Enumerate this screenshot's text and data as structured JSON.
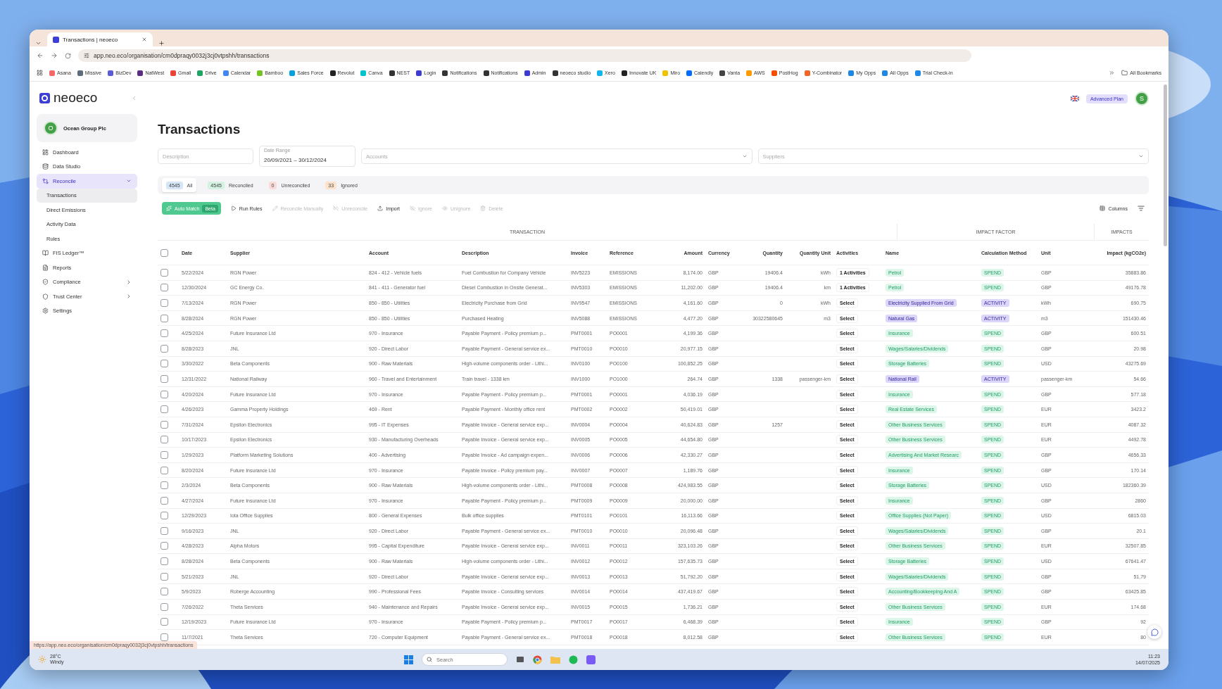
{
  "browser": {
    "tab_title": "Transactions | neoeco",
    "url": "app.neo.eco/organisation/cm0dpraqy0032j3cj0vtpshh/transactions",
    "bookmarks": [
      {
        "label": "Asana",
        "color": "#f06a6a"
      },
      {
        "label": "Missive",
        "color": "#5c6b7a"
      },
      {
        "label": "BizDev",
        "color": "#5b5bd6"
      },
      {
        "label": "NatWest",
        "color": "#5a2d82"
      },
      {
        "label": "Gmail",
        "color": "#ea4335"
      },
      {
        "label": "Drive",
        "color": "#1fa463"
      },
      {
        "label": "Calendar",
        "color": "#4285f4"
      },
      {
        "label": "Bamboo",
        "color": "#73c41d"
      },
      {
        "label": "Sales Force",
        "color": "#00a1e0"
      },
      {
        "label": "Revolut",
        "color": "#222222"
      },
      {
        "label": "Canva",
        "color": "#00c4cc"
      },
      {
        "label": "NEST",
        "color": "#333333"
      },
      {
        "label": "Login",
        "color": "#3b3bd6"
      },
      {
        "label": "Notifications",
        "color": "#333333"
      },
      {
        "label": "Notifications",
        "color": "#333333"
      },
      {
        "label": "Admin",
        "color": "#3b3bd6"
      },
      {
        "label": "neoeco studio",
        "color": "#333333"
      },
      {
        "label": "Xero",
        "color": "#13b5ea"
      },
      {
        "label": "Innovate UK",
        "color": "#222222"
      },
      {
        "label": "Miro",
        "color": "#f2c200"
      },
      {
        "label": "Calendly",
        "color": "#006bff"
      },
      {
        "label": "Vanta",
        "color": "#444444"
      },
      {
        "label": "AWS",
        "color": "#ff9900"
      },
      {
        "label": "PostHog",
        "color": "#f54e00"
      },
      {
        "label": "Y-Combinator",
        "color": "#f26522"
      },
      {
        "label": "My Opps",
        "color": "#1e88e5"
      },
      {
        "label": "All Opps",
        "color": "#1e88e5"
      },
      {
        "label": "Trial Check-in",
        "color": "#1e88e5"
      }
    ],
    "all_bookmarks": "All Bookmarks",
    "status_url": "https://app.neo.eco/organisation/cm0dpraqy0032j3cj0vtpshh/transactions"
  },
  "sidebar": {
    "logo": "neoeco",
    "organisation": {
      "initial": "O",
      "name": "Ocean Group Plc"
    },
    "items": [
      {
        "label": "Dashboard",
        "selected": false
      },
      {
        "label": "Data Studio",
        "selected": false
      },
      {
        "label": "Reconcile",
        "selected": true,
        "expanded": true,
        "children": [
          {
            "label": "Transactions",
            "selected": true
          },
          {
            "label": "Direct Emissions",
            "selected": false
          },
          {
            "label": "Activity Data",
            "selected": false
          },
          {
            "label": "Rules",
            "selected": false
          }
        ]
      },
      {
        "label": "FIS Ledger™",
        "selected": false
      },
      {
        "label": "Reports",
        "selected": false
      },
      {
        "label": "Compliance",
        "selected": false,
        "expanded": false
      },
      {
        "label": "Trust Center",
        "selected": false,
        "expanded": false
      },
      {
        "label": "Settings",
        "selected": false
      }
    ]
  },
  "header": {
    "plan": "Advanced Plan",
    "avatar": "S"
  },
  "page_title": "Transactions",
  "filters": {
    "description": {
      "placeholder": "Description"
    },
    "date_range": {
      "label": "Date Range",
      "value": "20/09/2021 – 30/12/2024"
    },
    "accounts": {
      "placeholder": "Accounts"
    },
    "suppliers": {
      "placeholder": "Suppliers"
    }
  },
  "tabs": [
    {
      "count": "4545",
      "label": "All",
      "selected": true,
      "color": "#d6e6f7"
    },
    {
      "count": "4545",
      "label": "Reconciled",
      "selected": false,
      "color": "#d3f2e2"
    },
    {
      "count": "0",
      "label": "Unreconciled",
      "selected": false,
      "color": "#fbdada"
    },
    {
      "count": "33",
      "label": "Ignored",
      "selected": false,
      "color": "#fde3cc"
    }
  ],
  "toolbar": {
    "buttons": [
      {
        "label": "Auto Match",
        "badge": "Beta",
        "kind": "primary",
        "disabled": false
      },
      {
        "label": "Run Rules",
        "kind": "plain",
        "disabled": false
      },
      {
        "label": "Reconcile Manually",
        "kind": "plain",
        "disabled": true
      },
      {
        "label": "Unreconcile",
        "kind": "plain",
        "disabled": true
      },
      {
        "label": "Import",
        "kind": "plain",
        "disabled": false
      },
      {
        "label": "Ignore",
        "kind": "plain",
        "disabled": true
      },
      {
        "label": "Unignore",
        "kind": "plain",
        "disabled": true
      },
      {
        "label": "Delete",
        "kind": "plain",
        "disabled": true
      }
    ],
    "columns_button": "Columns"
  },
  "table": {
    "groups": [
      "TRANSACTION",
      "IMPACT FACTOR",
      "IMPACTS"
    ],
    "select_all_checked": false,
    "columns": [
      "Date",
      "Supplier",
      "Account",
      "Description",
      "Invoice",
      "Reference",
      "Amount",
      "Currency",
      "Quantity",
      "Quantity Unit",
      "Activities",
      "Name",
      "Calculation Method",
      "Unit",
      "Impact (kgCO2e)"
    ],
    "rows": [
      {
        "checked": false,
        "date": "5/22/2024",
        "supplier": "RGN Power",
        "account": "824 - 412 - Vehicle fuels",
        "description": "Fuel Combustion for Company Vehicle",
        "invoice": "INV5223",
        "reference": "EMISSIONS",
        "amount": "8,174.00",
        "currency": "GBP",
        "quantity": "19406.4",
        "quantity_unit": "kWh",
        "activities": "1 Activities",
        "name": "Petrol",
        "kind": "spend",
        "method": "SPEND",
        "unit": "GBP",
        "impact": "35883.86"
      },
      {
        "checked": false,
        "date": "12/30/2024",
        "supplier": "GC Energy Co.",
        "account": "841 - 411 - Generator fuel",
        "description": "Diesel Combustion in Onsite Generat...",
        "invoice": "INV5303",
        "reference": "EMISSIONS",
        "amount": "11,202.00",
        "currency": "GBP",
        "quantity": "19406.4",
        "quantity_unit": "km",
        "activities": "1 Activities",
        "name": "Petrol",
        "kind": "spend",
        "method": "SPEND",
        "unit": "GBP",
        "impact": "49176.78"
      },
      {
        "checked": false,
        "date": "7/13/2024",
        "supplier": "RGN Power",
        "account": "850 - 850 - Utilities",
        "description": "Electricity Purchase from Grid",
        "invoice": "INV9547",
        "reference": "EMISSIONS",
        "amount": "4,161.60",
        "currency": "GBP",
        "quantity": "0",
        "quantity_unit": "kWh",
        "activities": "Select",
        "name": "Electricity Supplied From Grid",
        "kind": "activity",
        "method": "ACTIVITY",
        "unit": "kWh",
        "impact": "690.75"
      },
      {
        "checked": false,
        "date": "8/28/2024",
        "supplier": "RGN Power",
        "account": "850 - 850 - Utilities",
        "description": "Purchased Heating",
        "invoice": "INV5088",
        "reference": "EMISSIONS",
        "amount": "4,477.20",
        "currency": "GBP",
        "quantity": "30322580645",
        "quantity_unit": "m3",
        "activities": "Select",
        "name": "Natural Gas",
        "kind": "activity",
        "method": "ACTIVITY",
        "unit": "m3",
        "impact": "151430.46"
      },
      {
        "checked": false,
        "date": "4/25/2024",
        "supplier": "Future Insurance Ltd",
        "account": "970 - Insurance",
        "description": "Payable Payment - Policy premium p...",
        "invoice": "PMT0001",
        "reference": "PO0001",
        "amount": "4,199.36",
        "currency": "GBP",
        "activities": "Select",
        "name": "Insurance",
        "kind": "spend",
        "method": "SPEND",
        "unit": "GBP",
        "impact": "600.51"
      },
      {
        "checked": false,
        "date": "8/28/2023",
        "supplier": "JNL",
        "account": "920 - Direct Labor",
        "description": "Payable Payment - General service ex...",
        "invoice": "PMT0010",
        "reference": "PO0010",
        "amount": "20,977.15",
        "currency": "GBP",
        "activities": "Select",
        "name": "Wages/Salaries/Dividends",
        "kind": "spend",
        "method": "SPEND",
        "unit": "GBP",
        "impact": "20.98"
      },
      {
        "checked": false,
        "date": "3/30/2022",
        "supplier": "Beta Components",
        "account": "900 - Raw Materials",
        "description": "High-volume components order - Lithi...",
        "invoice": "INV0100",
        "reference": "PO0100",
        "amount": "100,852.25",
        "currency": "GBP",
        "activities": "Select",
        "name": "Storage Batteries",
        "kind": "spend",
        "method": "SPEND",
        "unit": "USD",
        "impact": "43275.69"
      },
      {
        "checked": false,
        "date": "12/31/2022",
        "supplier": "National Railway",
        "account": "960 - Travel and Entertainment",
        "description": "Train travel - 1338 km",
        "invoice": "INV1000",
        "reference": "PO1000",
        "amount": "264.74",
        "currency": "GBP",
        "quantity": "1338",
        "quantity_unit": "passenger-km",
        "activities": "Select",
        "name": "National Rail",
        "kind": "activity",
        "method": "ACTIVITY",
        "unit": "passenger-km",
        "impact": "54.66"
      },
      {
        "checked": false,
        "date": "4/20/2024",
        "supplier": "Future Insurance Ltd",
        "account": "970 - Insurance",
        "description": "Payable Payment - Policy premium p...",
        "invoice": "PMT0001",
        "reference": "PO0001",
        "amount": "4,036.19",
        "currency": "GBP",
        "activities": "Select",
        "name": "Insurance",
        "kind": "spend",
        "method": "SPEND",
        "unit": "GBP",
        "impact": "577.18"
      },
      {
        "checked": false,
        "date": "4/26/2023",
        "supplier": "Gamma Property Holdings",
        "account": "469 - Rent",
        "description": "Payable Payment - Monthly office rent",
        "invoice": "PMT0002",
        "reference": "PO0002",
        "amount": "50,419.01",
        "currency": "GBP",
        "activities": "Select",
        "name": "Real Estate Services",
        "kind": "spend",
        "method": "SPEND",
        "unit": "EUR",
        "impact": "3423.2"
      },
      {
        "checked": false,
        "date": "7/31/2024",
        "supplier": "Epsilon Electronics",
        "account": "995 - IT Expenses",
        "description": "Payable Invoice - General service exp...",
        "invoice": "INV0004",
        "reference": "PO0004",
        "amount": "40,624.83",
        "currency": "GBP",
        "quantity": "1257",
        "activities": "Select",
        "name": "Other Business Services",
        "kind": "spend",
        "method": "SPEND",
        "unit": "EUR",
        "impact": "4087.32"
      },
      {
        "checked": false,
        "date": "10/17/2023",
        "supplier": "Epsilon Electronics",
        "account": "930 - Manufacturing Overheads",
        "description": "Payable Invoice - General service exp...",
        "invoice": "INV0005",
        "reference": "PO0005",
        "amount": "44,654.80",
        "currency": "GBP",
        "activities": "Select",
        "name": "Other Business Services",
        "kind": "spend",
        "method": "SPEND",
        "unit": "EUR",
        "impact": "4492.78"
      },
      {
        "checked": false,
        "date": "1/29/2023",
        "supplier": "Platform Marketing Solutions",
        "account": "400 - Advertising",
        "description": "Payable Invoice - Ad campaign expen...",
        "invoice": "INV0006",
        "reference": "PO0006",
        "amount": "42,330.27",
        "currency": "GBP",
        "activities": "Select",
        "name": "Advertising And Market Researc",
        "kind": "spend",
        "method": "SPEND",
        "unit": "GBP",
        "impact": "4656.33"
      },
      {
        "checked": false,
        "date": "8/20/2024",
        "supplier": "Future Insurance Ltd",
        "account": "970 - Insurance",
        "description": "Payable Invoice - Policy premium pay...",
        "invoice": "INV0007",
        "reference": "PO0007",
        "amount": "1,189.76",
        "currency": "GBP",
        "activities": "Select",
        "name": "Insurance",
        "kind": "spend",
        "method": "SPEND",
        "unit": "GBP",
        "impact": "170.14"
      },
      {
        "checked": false,
        "date": "2/3/2024",
        "supplier": "Beta Components",
        "account": "900 - Raw Materials",
        "description": "High-volume components order - Lithi...",
        "invoice": "PMT0008",
        "reference": "PO0008",
        "amount": "424,983.55",
        "currency": "GBP",
        "activities": "Select",
        "name": "Storage Batteries",
        "kind": "spend",
        "method": "SPEND",
        "unit": "USD",
        "impact": "182360.39"
      },
      {
        "checked": false,
        "date": "4/27/2024",
        "supplier": "Future Insurance Ltd",
        "account": "970 - Insurance",
        "description": "Payable Payment - Policy premium p...",
        "invoice": "PMT0009",
        "reference": "PO0009",
        "amount": "20,000.00",
        "currency": "GBP",
        "activities": "Select",
        "name": "Insurance",
        "kind": "spend",
        "method": "SPEND",
        "unit": "GBP",
        "impact": "2860"
      },
      {
        "checked": false,
        "date": "12/29/2023",
        "supplier": "Iota Office Supplies",
        "account": "800 - General Expenses",
        "description": "Bulk office supplies",
        "invoice": "PMT0101",
        "reference": "PO0101",
        "amount": "16,113.66",
        "currency": "GBP",
        "activities": "Select",
        "name": "Office Supplies (Not Paper)",
        "kind": "spend",
        "method": "SPEND",
        "unit": "USD",
        "impact": "6815.03"
      },
      {
        "checked": false,
        "date": "9/16/2023",
        "supplier": "JNL",
        "account": "920 - Direct Labor",
        "description": "Payable Payment - General service ex...",
        "invoice": "PMT0010",
        "reference": "PO0010",
        "amount": "20,096.48",
        "currency": "GBP",
        "activities": "Select",
        "name": "Wages/Salaries/Dividends",
        "kind": "spend",
        "method": "SPEND",
        "unit": "GBP",
        "impact": "20.1"
      },
      {
        "checked": false,
        "date": "4/28/2023",
        "supplier": "Alpha Motors",
        "account": "995 - Capital Expenditure",
        "description": "Payable Invoice - General service exp...",
        "invoice": "INV0011",
        "reference": "PO0011",
        "amount": "323,103.26",
        "currency": "GBP",
        "activities": "Select",
        "name": "Other Business Services",
        "kind": "spend",
        "method": "SPEND",
        "unit": "EUR",
        "impact": "32507.85"
      },
      {
        "checked": false,
        "date": "8/28/2024",
        "supplier": "Beta Components",
        "account": "900 - Raw Materials",
        "description": "High-volume components order - Lithi...",
        "invoice": "INV0012",
        "reference": "PO0012",
        "amount": "157,635.73",
        "currency": "GBP",
        "activities": "Select",
        "name": "Storage Batteries",
        "kind": "spend",
        "method": "SPEND",
        "unit": "USD",
        "impact": "67641.47"
      },
      {
        "checked": false,
        "date": "5/21/2023",
        "supplier": "JNL",
        "account": "920 - Direct Labor",
        "description": "Payable Invoice - General service exp...",
        "invoice": "INV0013",
        "reference": "PO0013",
        "amount": "51,792.20",
        "currency": "GBP",
        "activities": "Select",
        "name": "Wages/Salaries/Dividends",
        "kind": "spend",
        "method": "SPEND",
        "unit": "GBP",
        "impact": "51.79"
      },
      {
        "checked": false,
        "date": "5/9/2023",
        "supplier": "Roberge Accounting",
        "account": "990 - Professional Fees",
        "description": "Payable Invoice - Consulting services",
        "invoice": "INV0014",
        "reference": "PO0014",
        "amount": "437,419.67",
        "currency": "GBP",
        "activities": "Select",
        "name": "Accounting/Bookkeeping And A",
        "kind": "spend",
        "method": "SPEND",
        "unit": "GBP",
        "impact": "63425.85"
      },
      {
        "checked": false,
        "date": "7/26/2022",
        "supplier": "Theta Services",
        "account": "940 - Maintenance and Repairs",
        "description": "Payable Invoice - General service exp...",
        "invoice": "INV0015",
        "reference": "PO0015",
        "amount": "1,736.21",
        "currency": "GBP",
        "activities": "Select",
        "name": "Other Business Services",
        "kind": "spend",
        "method": "SPEND",
        "unit": "EUR",
        "impact": "174.68"
      },
      {
        "checked": false,
        "date": "12/19/2023",
        "supplier": "Future Insurance Ltd",
        "account": "970 - Insurance",
        "description": "Payable Payment - Policy premium p...",
        "invoice": "PMT0017",
        "reference": "PO0017",
        "amount": "6,468.39",
        "currency": "GBP",
        "activities": "Select",
        "name": "Insurance",
        "kind": "spend",
        "method": "SPEND",
        "unit": "GBP",
        "impact": "92"
      },
      {
        "checked": false,
        "date": "11/7/2021",
        "supplier": "Theta Services",
        "account": "720 - Computer Equipment",
        "description": "Payable Payment - General service ex...",
        "invoice": "PMT0018",
        "reference": "PO0018",
        "amount": "8,012.58",
        "currency": "GBP",
        "activities": "Select",
        "name": "Other Business Services",
        "kind": "spend",
        "method": "SPEND",
        "unit": "EUR",
        "impact": "80"
      }
    ]
  },
  "taskbar": {
    "temperature": "28°C",
    "weather": "Windy",
    "search_placeholder": "Search",
    "time": "11:23",
    "date": "14/07/2025"
  }
}
